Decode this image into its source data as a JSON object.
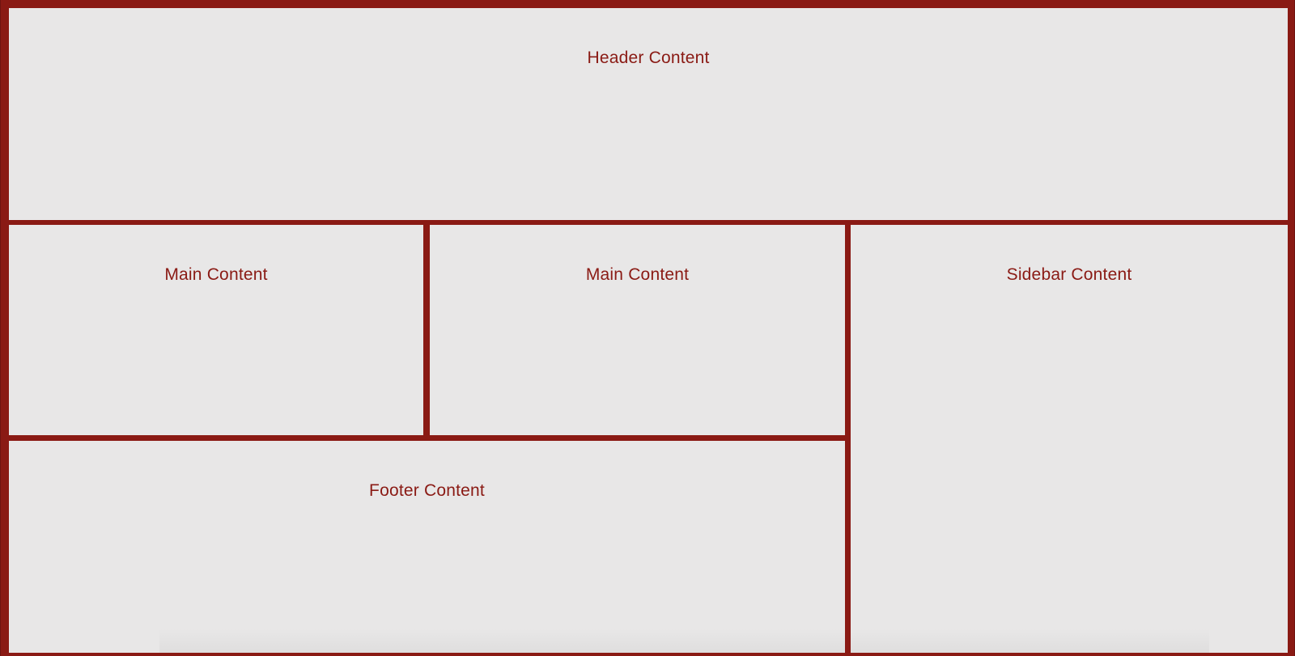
{
  "header": {
    "label": "Header Content"
  },
  "main": [
    {
      "label": "Main Content"
    },
    {
      "label": "Main Content"
    }
  ],
  "sidebar": {
    "label": "Sidebar Content"
  },
  "footer": {
    "label": "Footer Content"
  },
  "colors": {
    "border": "#8a1a14",
    "panel_bg": "#e8e7e7",
    "text": "#8a1a14"
  }
}
